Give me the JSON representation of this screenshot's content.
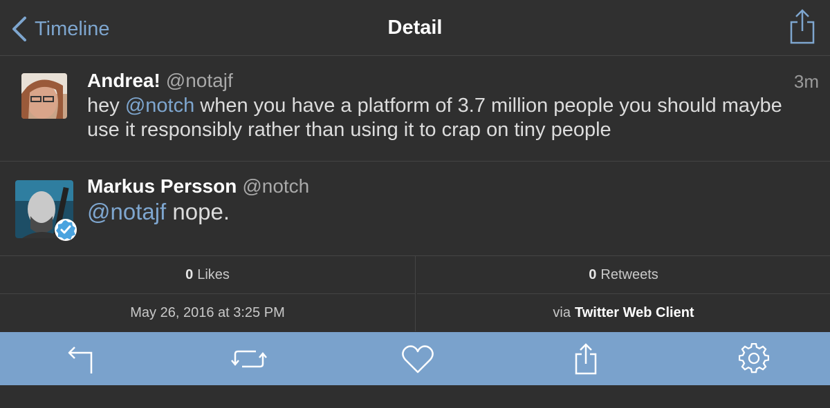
{
  "nav": {
    "back_label": "Timeline",
    "title": "Detail",
    "icons": {
      "back": "chevron-left-icon",
      "share": "share-icon"
    }
  },
  "tweets": [
    {
      "name": "Andrea!",
      "handle": "@notajf",
      "time": "3m",
      "text_before": "hey ",
      "mention": "@notch",
      "text_after": " when you have a platform of 3.7 million people you should maybe use it responsibly rather than using it to crap on tiny people"
    },
    {
      "name": "Markus Persson",
      "handle": "@notch",
      "mention": "@notajf",
      "text_after": " nope.",
      "verified": true
    }
  ],
  "stats": {
    "likes_count": "0",
    "likes_label": "Likes",
    "retweets_count": "0",
    "retweets_label": "Retweets",
    "timestamp": "May 26, 2016 at 3:25 PM",
    "via_prefix": "via",
    "via_app": "Twitter Web Client"
  },
  "toolbar": {
    "icons": [
      "reply-icon",
      "retweet-icon",
      "heart-icon",
      "share-icon",
      "gear-icon"
    ]
  },
  "colors": {
    "accent": "#7ea6cf",
    "toolbar": "#7aa2cc",
    "background": "#2f2f2f"
  }
}
